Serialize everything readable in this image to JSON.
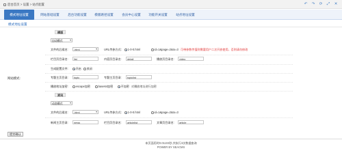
{
  "breadcrumb": {
    "text": "后台首页 > 设置 > 站点配置"
  },
  "tabs": [
    "模式地址设置",
    "网站基础设置",
    "后台功能设置",
    "模版路径设置",
    "会员中心设置",
    "功能开关设置",
    "站点地址设置"
  ],
  "subtab": "模式地址设置",
  "left_label": "网站模式:",
  "section1": {
    "title": "模版",
    "mode_value": "自动模式",
    "suffix_label": "文件的后缀名:",
    "suffix_value": ".html",
    "url_label": "URL传参方式:",
    "url_opt1": "1-0-0.html",
    "url_opt2": "id=1&page=2&to=3",
    "url_hint": "可带参数传值则需要用户二次开放使用，否则请勿修改",
    "col_dir_label": "栏目页目录名:",
    "col_dir_value": "list",
    "content_dir_label": "内容页目录名:",
    "content_dir_value": "detail",
    "topic_dir_label": "播放页目录名:",
    "topic_dir_value": "video",
    "static_label": "生成配置文件:",
    "static_on": "开启",
    "static_off": "关闭",
    "topic_index_label": "专题主页目录:",
    "topic_index_value": "topic",
    "topic_list_label": "专题主页目录:",
    "topic_list_value": "topiclist",
    "encode_label": "播放地址加密:",
    "encode_opt1": "escape加密",
    "encode_opt2": "base64加密",
    "encode_opt3": "不加密",
    "encode_hint": "对播放地址进行加密"
  },
  "section2": {
    "title": "资讯",
    "mode_value": "动态模式",
    "suffix_label": "文件的后缀名:",
    "suffix_value": ".html",
    "url_label": "URL传参方式:",
    "url_opt1": "1-0-0.html",
    "url_opt2": "id=1&page=2&to=3",
    "news_dir_label": "新闻主页目录:",
    "news_dir_value": "news",
    "list_dir_label": "栏目页目录名:",
    "list_dir_value": "articlelist",
    "article_dir_label": "文章页目录名:",
    "article_dir_value": "article"
  },
  "submit_label": "提交确认",
  "footer": {
    "line1": "本页面用时0.01103秒,共执行3次数据查询",
    "line2": "POWER BY SEACMS"
  }
}
